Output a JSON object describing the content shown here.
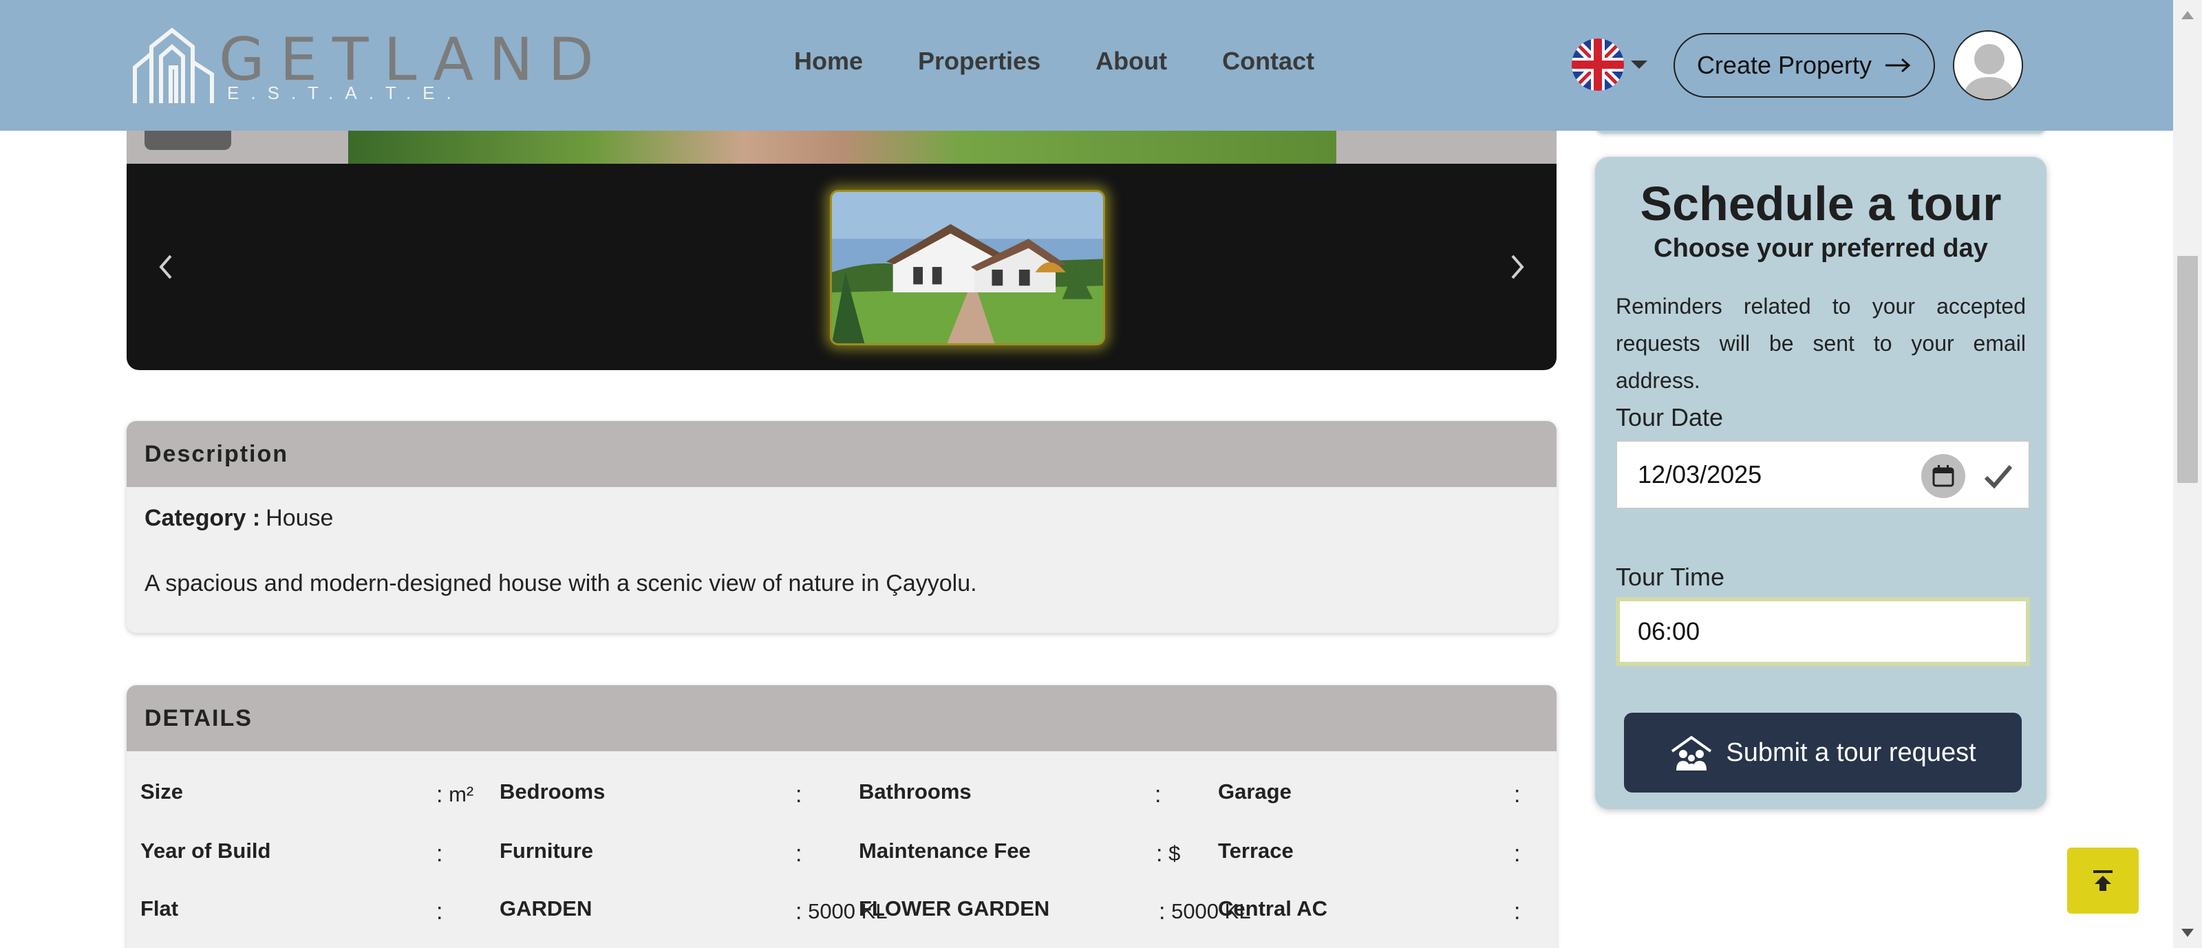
{
  "header": {
    "logo_word": "GETLAND",
    "logo_sub": "E.S.T.A.T.E.",
    "nav": [
      "Home",
      "Properties",
      "About",
      "Contact"
    ],
    "language_icon": "uk-flag-icon",
    "create_property_label": "Create Property",
    "avatar_icon": "user-avatar-icon"
  },
  "gallery": {
    "prev_icon": "chevron-left-icon",
    "next_icon": "chevron-right-icon"
  },
  "description": {
    "heading": "Description",
    "category_label": "Category :",
    "category_value": "House",
    "text": "A spacious and modern-designed house with a scenic view of nature in Çayyolu."
  },
  "details": {
    "heading": "DETAILS",
    "rows": [
      [
        {
          "label": "Size",
          "value": "m²"
        },
        {
          "label": "Bedrooms",
          "value": ""
        },
        {
          "label": "Bathrooms",
          "value": ""
        },
        {
          "label": "Garage",
          "value": ""
        }
      ],
      [
        {
          "label": "Year of Build",
          "value": ""
        },
        {
          "label": "Furniture",
          "value": ""
        },
        {
          "label": "Maintenance Fee",
          "value": "$"
        },
        {
          "label": "Terrace",
          "value": ""
        }
      ],
      [
        {
          "label": "Flat",
          "value": ""
        },
        {
          "label": "GARDEN",
          "value": "5000 KL"
        },
        {
          "label": "FLOWER GARDEN",
          "value": "5000 KL"
        },
        {
          "label": "Central AC",
          "value": ""
        }
      ]
    ]
  },
  "tour": {
    "title": "Schedule a tour",
    "subtitle": "Choose your preferred day",
    "note": "Reminders related to your accepted requests will be sent to your email address.",
    "date_label": "Tour Date",
    "date_value": "12/03/2025",
    "time_label": "Tour Time",
    "time_value": "06:00",
    "submit_label": "Submit a tour request"
  },
  "colors": {
    "header_bg": "#8fb1cb",
    "sidebar_bg": "#b9d0d9",
    "submit_bg": "#273449",
    "scroll_top_bg": "#ded11a"
  }
}
